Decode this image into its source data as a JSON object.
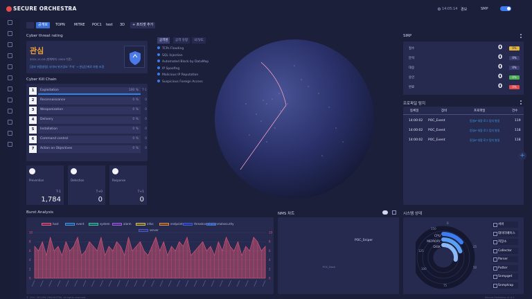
{
  "app": {
    "logo": "SECURE ORCHESTRA"
  },
  "topbar": {
    "time": "14:05:14",
    "alert_label": "경보",
    "smp_label": "SMP",
    "chips": [
      {
        "label": "공개보",
        "active": true
      },
      {
        "label": "TOPN",
        "active": false
      },
      {
        "label": "MITRE",
        "active": false
      },
      {
        "label": "POC1",
        "active": false
      },
      {
        "label": "test",
        "active": false
      },
      {
        "label": "3D",
        "active": false
      },
      {
        "label": "+ 프리셋 추가",
        "active": false
      }
    ]
  },
  "threat": {
    "title": "Cyber threat rating",
    "level": "관심",
    "date": "2021-11-03 (현재까지: 2004 기준)",
    "notice": "[경보 위협발령] 사이버 위기경보 '주의' → 관심단계로 하향 조정"
  },
  "killchain": {
    "title": "Cyber Kill Chain",
    "rows": [
      {
        "num": "1",
        "label": "Exploitation",
        "pct": "100 %",
        "side": "T-1",
        "fill": 100
      },
      {
        "num": "2",
        "label": "Reconnaissance",
        "pct": "0 %",
        "side": "0",
        "fill": 0
      },
      {
        "num": "3",
        "label": "Weaponization",
        "pct": "0 %",
        "side": "0",
        "fill": 0
      },
      {
        "num": "4",
        "label": "Delivery",
        "pct": "0 %",
        "side": "0",
        "fill": 0
      },
      {
        "num": "5",
        "label": "Installation",
        "pct": "0 %",
        "side": "0",
        "fill": 0
      },
      {
        "num": "6",
        "label": "Command control",
        "pct": "0 %",
        "side": "0",
        "fill": 0
      },
      {
        "num": "7",
        "label": "Action on Objectives",
        "pct": "0 %",
        "side": "0",
        "fill": 0
      }
    ]
  },
  "stats": [
    {
      "label": "Prevention",
      "t": "T-1",
      "value": "1,784"
    },
    {
      "label": "Detection",
      "t": "T+0",
      "value": "0"
    },
    {
      "label": "Response",
      "t": "T+1",
      "value": "0"
    }
  ],
  "attack": {
    "tabs": [
      "공격명",
      "공격 유형",
      "국가/도"
    ],
    "items": [
      "TCPs Flooding",
      "SQL Injection",
      "Automated Block by DataMap",
      "IP Spoofing",
      "Malicious IP Reputation",
      "Suspicious Foreign Access"
    ]
  },
  "sirp": {
    "title": "SIRP",
    "rows": [
      {
        "label": "접수",
        "value": "0",
        "pct": "0%",
        "color": "#e6b43a"
      },
      {
        "label": "분석",
        "value": "0",
        "pct": "0%",
        "color": "#3a3f72"
      },
      {
        "label": "대응",
        "value": "0",
        "pct": "0%",
        "color": "#3a3f72"
      },
      {
        "label": "승인",
        "value": "0",
        "pct": "0%",
        "color": "#4caf50"
      },
      {
        "label": "완료",
        "value": "0",
        "pct": "0%",
        "color": "#e84a4a"
      }
    ]
  },
  "profile": {
    "title": "프로파일 탐지",
    "headers": [
      "등록일",
      "장비",
      "프로파일",
      "건수"
    ],
    "rows": [
      {
        "date": "14:00:02",
        "device": "POC_Event",
        "profile": "동일IP 대량 로그 탐지 발생",
        "count": "119"
      },
      {
        "date": "14:00:02",
        "device": "POC_Event",
        "profile": "동일IP 대량 로그 탐지 발생",
        "count": "118"
      },
      {
        "date": "14:00:02",
        "device": "POC_Event",
        "profile": "동일IP 대량 로그 탐지 발생",
        "count": "118"
      }
    ]
  },
  "burst": {
    "title": "Burst Analysis",
    "legend": [
      {
        "label": "host",
        "color": "#e8587a"
      },
      {
        "label": "event",
        "color": "#3a9be8"
      },
      {
        "label": "system",
        "color": "#3ac4a0"
      },
      {
        "label": "alarm",
        "color": "#a05ae8"
      },
      {
        "label": "infos",
        "color": "#d8c050"
      },
      {
        "label": "endpoint",
        "color": "#e88a3a"
      },
      {
        "label": "threatcorrelation",
        "color": "#3a5ae8"
      },
      {
        "label": "malsecurity",
        "color": "#3a6fd8"
      },
      {
        "label": "server",
        "color": "#4a58c8"
      }
    ],
    "ytick_labels": [
      "10",
      "8",
      "6",
      "4",
      "2",
      "0"
    ],
    "chart_data": {
      "type": "area",
      "ylim": [
        0,
        10
      ],
      "series": [
        {
          "name": "host",
          "values": [
            7,
            6,
            8,
            5,
            9,
            6,
            7,
            5,
            8,
            6,
            7,
            9,
            5,
            6,
            8,
            7,
            6,
            9,
            5,
            7,
            6,
            8,
            7,
            5,
            9,
            6,
            7,
            8,
            6,
            5,
            7,
            9,
            6,
            8,
            5,
            7,
            6,
            8,
            7,
            9,
            5,
            6,
            7,
            8,
            6,
            7,
            5,
            8,
            6,
            9,
            7,
            6,
            8,
            5,
            7,
            6,
            9,
            8,
            6,
            7
          ]
        }
      ]
    }
  },
  "nms": {
    "title": "NMS 차트",
    "label_main": "POC_Sniper",
    "label_sub": "POC_Dash"
  },
  "system": {
    "title": "시스템 상태",
    "ring_labels": [
      "CPU",
      "MEMORY",
      "DISK"
    ],
    "scale_labels": [
      "0",
      "25",
      "50",
      "75",
      "100",
      "125",
      "150"
    ],
    "buttons": [
      "서버",
      "데이터베이스",
      "저장소",
      "Collector",
      "Parser",
      "Putter",
      "Snmpget",
      "Snmptrap"
    ]
  },
  "footer": {
    "copyright": "© 2021 SECURE ORCHESTRA. All rights reserved.",
    "version": "Secure Orchestra v1.0.1"
  }
}
